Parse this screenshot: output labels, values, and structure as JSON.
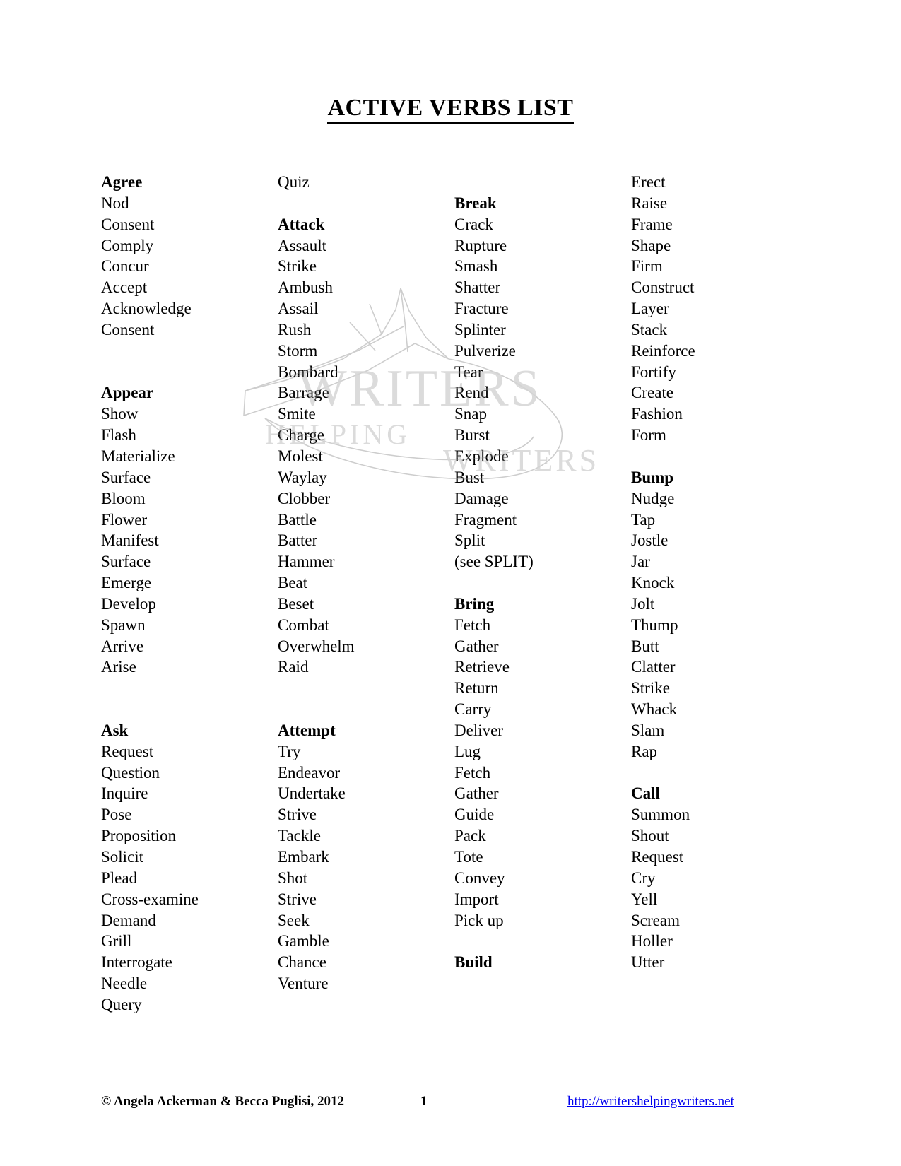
{
  "document": {
    "title": "ACTIVE VERBS LIST"
  },
  "watermark": {
    "line1": "WRITERS",
    "line2": "HELPING",
    "line3": "WRITERS"
  },
  "columns": [
    {
      "name": "column-1",
      "entries": [
        {
          "text": "Agree",
          "bold": true
        },
        {
          "text": "Nod",
          "bold": false
        },
        {
          "text": "Consent",
          "bold": false
        },
        {
          "text": "Comply",
          "bold": false
        },
        {
          "text": "Concur",
          "bold": false
        },
        {
          "text": "Accept",
          "bold": false
        },
        {
          "text": "Acknowledge",
          "bold": false
        },
        {
          "text": "Consent",
          "bold": false
        },
        {
          "text": "",
          "bold": false
        },
        {
          "text": "",
          "bold": false
        },
        {
          "text": "Appear",
          "bold": true
        },
        {
          "text": "Show",
          "bold": false
        },
        {
          "text": "Flash",
          "bold": false
        },
        {
          "text": "Materialize",
          "bold": false
        },
        {
          "text": "Surface",
          "bold": false
        },
        {
          "text": "Bloom",
          "bold": false
        },
        {
          "text": "Flower",
          "bold": false
        },
        {
          "text": "Manifest",
          "bold": false
        },
        {
          "text": "Surface",
          "bold": false
        },
        {
          "text": "Emerge",
          "bold": false
        },
        {
          "text": "Develop",
          "bold": false
        },
        {
          "text": "Spawn",
          "bold": false
        },
        {
          "text": "Arrive",
          "bold": false
        },
        {
          "text": "Arise",
          "bold": false
        },
        {
          "text": "",
          "bold": false
        },
        {
          "text": "",
          "bold": false
        },
        {
          "text": "Ask",
          "bold": true
        },
        {
          "text": "Request",
          "bold": false
        },
        {
          "text": "Question",
          "bold": false
        },
        {
          "text": "Inquire",
          "bold": false
        },
        {
          "text": "Pose",
          "bold": false
        },
        {
          "text": "Proposition",
          "bold": false
        },
        {
          "text": "Solicit",
          "bold": false
        },
        {
          "text": "Plead",
          "bold": false
        },
        {
          "text": "Cross-examine",
          "bold": false
        },
        {
          "text": "Demand",
          "bold": false
        },
        {
          "text": "Grill",
          "bold": false
        },
        {
          "text": "Interrogate",
          "bold": false
        },
        {
          "text": "Needle",
          "bold": false
        },
        {
          "text": "Query",
          "bold": false
        }
      ]
    },
    {
      "name": "column-2",
      "entries": [
        {
          "text": "Quiz",
          "bold": false
        },
        {
          "text": "",
          "bold": false
        },
        {
          "text": "Attack",
          "bold": true
        },
        {
          "text": "Assault",
          "bold": false
        },
        {
          "text": "Strike",
          "bold": false
        },
        {
          "text": "Ambush",
          "bold": false
        },
        {
          "text": "Assail",
          "bold": false
        },
        {
          "text": "Rush",
          "bold": false
        },
        {
          "text": "Storm",
          "bold": false
        },
        {
          "text": "Bombard",
          "bold": false
        },
        {
          "text": "Barrage",
          "bold": false
        },
        {
          "text": "Smite",
          "bold": false
        },
        {
          "text": "Charge",
          "bold": false
        },
        {
          "text": "Molest",
          "bold": false
        },
        {
          "text": "Waylay",
          "bold": false
        },
        {
          "text": "Clobber",
          "bold": false
        },
        {
          "text": "Battle",
          "bold": false
        },
        {
          "text": "Batter",
          "bold": false
        },
        {
          "text": "Hammer",
          "bold": false
        },
        {
          "text": "Beat",
          "bold": false
        },
        {
          "text": "Beset",
          "bold": false
        },
        {
          "text": "Combat",
          "bold": false
        },
        {
          "text": "Overwhelm",
          "bold": false
        },
        {
          "text": "Raid",
          "bold": false
        },
        {
          "text": "",
          "bold": false
        },
        {
          "text": "",
          "bold": false
        },
        {
          "text": "Attempt",
          "bold": true
        },
        {
          "text": "Try",
          "bold": false
        },
        {
          "text": "Endeavor",
          "bold": false
        },
        {
          "text": "Undertake",
          "bold": false
        },
        {
          "text": "Strive",
          "bold": false
        },
        {
          "text": "Tackle",
          "bold": false
        },
        {
          "text": "Embark",
          "bold": false
        },
        {
          "text": "Shot",
          "bold": false
        },
        {
          "text": "Strive",
          "bold": false
        },
        {
          "text": "Seek",
          "bold": false
        },
        {
          "text": "Gamble",
          "bold": false
        },
        {
          "text": "Chance",
          "bold": false
        },
        {
          "text": "Venture",
          "bold": false
        }
      ]
    },
    {
      "name": "column-3",
      "entries": [
        {
          "text": "",
          "bold": false
        },
        {
          "text": "Break",
          "bold": true
        },
        {
          "text": "Crack",
          "bold": false
        },
        {
          "text": "Rupture",
          "bold": false
        },
        {
          "text": "Smash",
          "bold": false
        },
        {
          "text": "Shatter",
          "bold": false
        },
        {
          "text": "Fracture",
          "bold": false
        },
        {
          "text": "Splinter",
          "bold": false
        },
        {
          "text": "Pulverize",
          "bold": false
        },
        {
          "text": "Tear",
          "bold": false
        },
        {
          "text": "Rend",
          "bold": false
        },
        {
          "text": "Snap",
          "bold": false
        },
        {
          "text": "Burst",
          "bold": false
        },
        {
          "text": "Explode",
          "bold": false
        },
        {
          "text": "Bust",
          "bold": false
        },
        {
          "text": "Damage",
          "bold": false
        },
        {
          "text": "Fragment",
          "bold": false
        },
        {
          "text": "Split",
          "bold": false
        },
        {
          "text": "(see SPLIT)",
          "bold": false
        },
        {
          "text": "",
          "bold": false
        },
        {
          "text": "Bring",
          "bold": true
        },
        {
          "text": "Fetch",
          "bold": false
        },
        {
          "text": "Gather",
          "bold": false
        },
        {
          "text": "Retrieve",
          "bold": false
        },
        {
          "text": "Return",
          "bold": false
        },
        {
          "text": "Carry",
          "bold": false
        },
        {
          "text": "Deliver",
          "bold": false
        },
        {
          "text": "Lug",
          "bold": false
        },
        {
          "text": "Fetch",
          "bold": false
        },
        {
          "text": "Gather",
          "bold": false
        },
        {
          "text": "Guide",
          "bold": false
        },
        {
          "text": "Pack",
          "bold": false
        },
        {
          "text": "Tote",
          "bold": false
        },
        {
          "text": "Convey",
          "bold": false
        },
        {
          "text": "Import",
          "bold": false
        },
        {
          "text": "Pick up",
          "bold": false
        },
        {
          "text": "",
          "bold": false
        },
        {
          "text": "Build",
          "bold": true
        }
      ]
    },
    {
      "name": "column-4",
      "entries": [
        {
          "text": "Erect",
          "bold": false
        },
        {
          "text": "Raise",
          "bold": false
        },
        {
          "text": "Frame",
          "bold": false
        },
        {
          "text": "Shape",
          "bold": false
        },
        {
          "text": "Firm",
          "bold": false
        },
        {
          "text": "Construct",
          "bold": false
        },
        {
          "text": "Layer",
          "bold": false
        },
        {
          "text": "Stack",
          "bold": false
        },
        {
          "text": "Reinforce",
          "bold": false
        },
        {
          "text": "Fortify",
          "bold": false
        },
        {
          "text": "Create",
          "bold": false
        },
        {
          "text": "Fashion",
          "bold": false
        },
        {
          "text": "Form",
          "bold": false
        },
        {
          "text": "",
          "bold": false
        },
        {
          "text": "Bump",
          "bold": true
        },
        {
          "text": "Nudge",
          "bold": false
        },
        {
          "text": "Tap",
          "bold": false
        },
        {
          "text": "Jostle",
          "bold": false
        },
        {
          "text": "Jar",
          "bold": false
        },
        {
          "text": "Knock",
          "bold": false
        },
        {
          "text": "Jolt",
          "bold": false
        },
        {
          "text": "Thump",
          "bold": false
        },
        {
          "text": "Butt",
          "bold": false
        },
        {
          "text": "Clatter",
          "bold": false
        },
        {
          "text": "Strike",
          "bold": false
        },
        {
          "text": "Whack",
          "bold": false
        },
        {
          "text": "Slam",
          "bold": false
        },
        {
          "text": "Rap",
          "bold": false
        },
        {
          "text": "",
          "bold": false
        },
        {
          "text": "Call",
          "bold": true
        },
        {
          "text": "Summon",
          "bold": false
        },
        {
          "text": "Shout",
          "bold": false
        },
        {
          "text": "Request",
          "bold": false
        },
        {
          "text": "Cry",
          "bold": false
        },
        {
          "text": "Yell",
          "bold": false
        },
        {
          "text": "Scream",
          "bold": false
        },
        {
          "text": "Holler",
          "bold": false
        },
        {
          "text": "Utter",
          "bold": false
        }
      ]
    }
  ],
  "footer": {
    "copyright": "© Angela Ackerman & Becca Puglisi, 2012",
    "page_number": "1",
    "url": "http://writershelpingwriters.net"
  }
}
